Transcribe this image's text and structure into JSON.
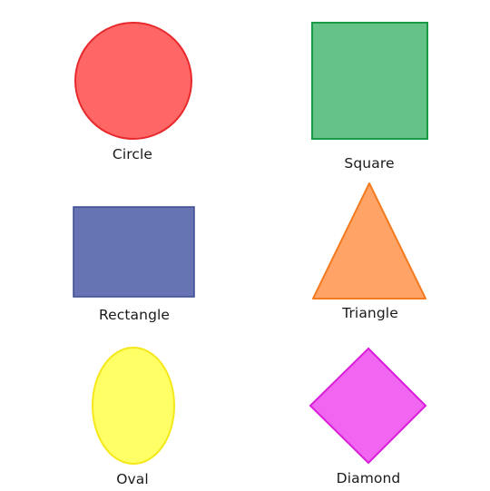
{
  "shapes": [
    {
      "id": "circle",
      "label": "Circle",
      "fill": "#ff6666",
      "stroke": "#e8292c"
    },
    {
      "id": "square",
      "label": "Square",
      "fill": "#66c387",
      "stroke": "#1a9a46"
    },
    {
      "id": "rectangle",
      "label": "Rectangle",
      "fill": "#6674b4",
      "stroke": "#3d4a8f"
    },
    {
      "id": "triangle",
      "label": "Triangle",
      "fill": "#ffa366",
      "stroke": "#f47a1f"
    },
    {
      "id": "oval",
      "label": "Oval",
      "fill": "#ffff66",
      "stroke": "#f5e81a"
    },
    {
      "id": "diamond",
      "label": "Diamond",
      "fill": "#f066f0",
      "stroke": "#d91ed9"
    }
  ]
}
